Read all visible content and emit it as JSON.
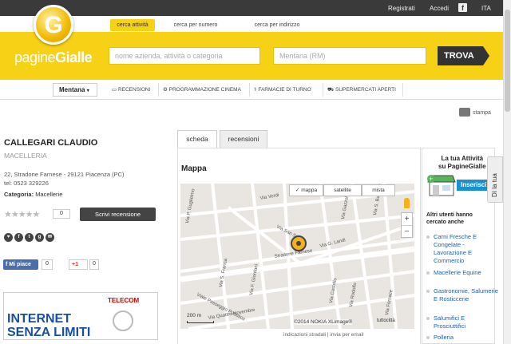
{
  "topbar": {
    "registrati": "Registrati",
    "accedi": "Accedi",
    "lang": "ITA"
  },
  "nav_tabs": [
    "cerca attività",
    "cerca per numero",
    "cerca per indirizzo"
  ],
  "logo": {
    "letter": "G",
    "text_a": "pagine",
    "text_b": "Gialle"
  },
  "search": {
    "what_placeholder": "nome azienda, attività o categoria",
    "where_value": "Mentana (RM)",
    "button": "TROVA"
  },
  "subnav": {
    "location": "Mentana",
    "items": [
      "RECENSIONI",
      "PROGRAMMAZIONE CINEMA",
      "FARMACIE DI TURNO",
      "SUPERMERCATI APERTI"
    ]
  },
  "print_label": "stampa",
  "business": {
    "name": "CALLEGARI CLAUDIO",
    "category": "MACELLERIA",
    "address": "22, Stradone Farnese - 29121 Piacenza (PC)",
    "tel": "tel: 0523 329226",
    "categoria_label": "Categoria:",
    "categoria_value": "Macellerie",
    "review_count": "0",
    "review_button": "Scrivi recensione"
  },
  "social": {
    "fb_like": "Mi piace",
    "fb_count": "0",
    "gplus": "+1",
    "gplus_count": "0"
  },
  "ad": {
    "brand": "TELECOM",
    "line1": "INTERNET",
    "line2": "SENZA LIMITI"
  },
  "tabs": [
    "scheda",
    "recensioni"
  ],
  "map": {
    "heading": "Mappa",
    "types": [
      "mappa",
      "satellite",
      "mista"
    ],
    "streets": [
      "Via San Siro",
      "Via G. Landi",
      "Stradone Farnese",
      "Via S. Franca",
      "Via F. Giordani",
      "Viale Passeggio Pubblico",
      "Via Quattro Novembre",
      "Via Castello",
      "Via Verdi",
      "Via Gazzola",
      "Via S. Bartolomeo",
      "Via P. Guglielmo",
      "Via Rodolfo",
      "Via Fornace"
    ],
    "scale": "200 m",
    "copyright": "©2014 NOKIA XLimage®",
    "tuttocitta": "tuttocittà"
  },
  "below_map": "indicazioni stradali   |   invia per email",
  "promo": {
    "title_a": "La tua Attività",
    "title_b": "su PagineGialle",
    "button": "Inserisci",
    "side_tab": "Dì la tua"
  },
  "altri": {
    "title": "Altri utenti hanno cercato anche",
    "items": [
      "Carni Fresche E Congelate - Lavorazione E Commercio",
      "Macellerie Equine",
      "Gastronomie, Salumerie E Rosticcerie",
      "Salumifici E Prosciuttifici",
      "Polleria"
    ]
  },
  "colors": {
    "brand_yellow": "#f7d116",
    "dark": "#3a3a3a",
    "link": "#1a5fb4"
  }
}
